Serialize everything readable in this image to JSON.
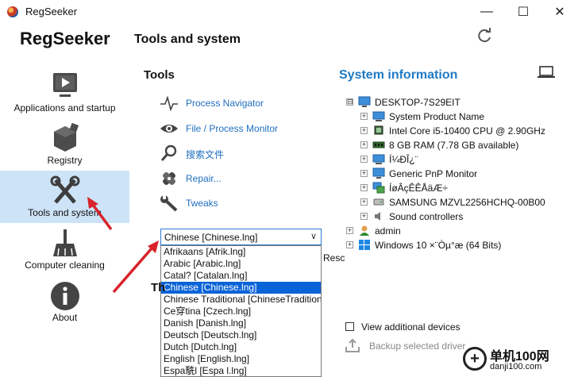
{
  "window": {
    "title": "RegSeeker",
    "minimize_glyph": "—",
    "maximize_glyph": "☐",
    "close_glyph": "✕"
  },
  "header": {
    "brand": "RegSeeker",
    "page_title": "Tools and system",
    "refresh_icon": "refresh-icon"
  },
  "sidebar": {
    "items": [
      {
        "label": "Applications and startup",
        "icon": "play-screen-icon",
        "active": false
      },
      {
        "label": "Registry",
        "icon": "registry-cube-icon",
        "active": false
      },
      {
        "label": "Tools and system",
        "icon": "tools-icon",
        "active": true
      },
      {
        "label": "Computer cleaning",
        "icon": "broom-icon",
        "active": false
      },
      {
        "label": "About",
        "icon": "info-icon",
        "active": false
      }
    ]
  },
  "tools": {
    "heading": "Tools",
    "items": [
      {
        "label": "Process Navigator",
        "icon": "pulse-icon"
      },
      {
        "label": "File / Process Monitor",
        "icon": "eye-icon"
      },
      {
        "label": "搜索文件",
        "icon": "search-icon"
      },
      {
        "label": "Repair...",
        "icon": "bandage-icon"
      },
      {
        "label": "Tweaks",
        "icon": "wrench-icon"
      }
    ]
  },
  "language": {
    "selected": "Chinese [Chinese.lng]",
    "options": [
      "Afrikaans [Afrik.lng]",
      "Arabic [Arabic.lng]",
      "Catal? [Catalan.lng]",
      "Chinese [Chinese.lng]",
      "Chinese Traditional [ChineseTradition",
      "Ce穿tina [Czech.lng]",
      "Danish [Danish.lng]",
      "Deutsch [Deutsch.lng]",
      "Dutch [Dutch.lng]",
      "English [English.lng]",
      "Espa駪l [Espa      l.lng]"
    ],
    "selected_index": 3,
    "partial_right": "Resc",
    "partial_heading": "Th"
  },
  "system_info": {
    "heading": "System information",
    "tree": [
      {
        "label": "DESKTOP-7S29EIT",
        "level": 0,
        "expander": "⊟",
        "icon": "monitor-icon"
      },
      {
        "label": "System Product Name",
        "level": 1,
        "expander": "+",
        "icon": "computer-icon"
      },
      {
        "label": "Intel Core i5-10400 CPU @ 2.90GHz",
        "level": 1,
        "expander": "+",
        "icon": "cpu-icon"
      },
      {
        "label": "8 GB RAM (7.78 GB available)",
        "level": 1,
        "expander": "+",
        "icon": "ram-icon"
      },
      {
        "label": "Í¼ÐÎ¿¨",
        "level": 1,
        "expander": "+",
        "icon": "display-adapter-icon"
      },
      {
        "label": "Generic PnP Monitor",
        "level": 1,
        "expander": "+",
        "icon": "monitor-icon"
      },
      {
        "label": "ÍøÂçÊÊÅäÆ÷",
        "level": 1,
        "expander": "+",
        "icon": "network-icon"
      },
      {
        "label": "SAMSUNG MZVL2256HCHQ-00B00",
        "level": 1,
        "expander": "+",
        "icon": "disk-icon"
      },
      {
        "label": "Sound controllers",
        "level": 1,
        "expander": "+",
        "icon": "speaker-icon"
      },
      {
        "label": "admin",
        "level": 0,
        "expander": "+",
        "icon": "user-icon"
      },
      {
        "label": "Windows 10 ×¨Òµ°æ (64 Bits)",
        "level": 0,
        "expander": "+",
        "icon": "windows-icon"
      }
    ],
    "view_additional_label": "View additional devices",
    "view_additional_checked": false,
    "backup_label": "Backup selected driver"
  },
  "watermark": {
    "text1": "单机100网",
    "text2": "danji100.com"
  },
  "colors": {
    "accent_blue": "#1f7ac4",
    "link_blue": "#1f6fbf",
    "sidebar_active": "#cde3f7",
    "selection": "#0a64d8",
    "arrow_red": "#d8232a"
  }
}
